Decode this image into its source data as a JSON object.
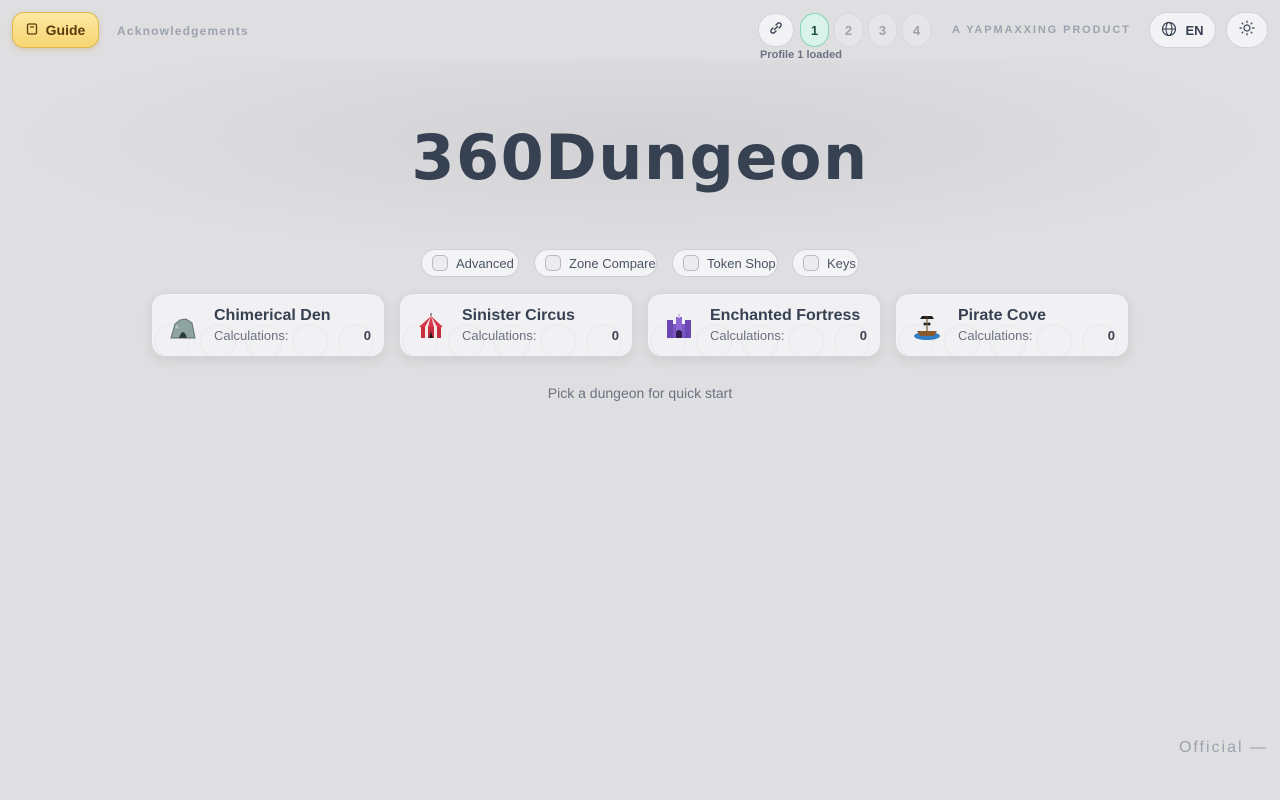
{
  "header": {
    "guide_label": "Guide",
    "acknowledgements_label": "Acknowledgements",
    "profiles": [
      "1",
      "2",
      "3",
      "4"
    ],
    "active_profile": "1",
    "profile_status": "Profile 1 loaded",
    "brand": "A YAPMAXXING PRODUCT",
    "language": "EN"
  },
  "main": {
    "title": "360Dungeon",
    "toggles": [
      {
        "label": "Advanced",
        "checked": false
      },
      {
        "label": "Zone Compare",
        "checked": false
      },
      {
        "label": "Token Shop",
        "checked": false
      },
      {
        "label": "Keys",
        "checked": false
      }
    ],
    "dungeons": [
      {
        "name": "Chimerical Den",
        "calc_label": "Calculations:",
        "calc_value": "0",
        "icon": "cave-icon"
      },
      {
        "name": "Sinister Circus",
        "calc_label": "Calculations:",
        "calc_value": "0",
        "icon": "circus-tent-icon"
      },
      {
        "name": "Enchanted Fortress",
        "calc_label": "Calculations:",
        "calc_value": "0",
        "icon": "castle-icon"
      },
      {
        "name": "Pirate Cove",
        "calc_label": "Calculations:",
        "calc_value": "0",
        "icon": "pirate-ship-icon"
      }
    ],
    "hint": "Pick a dungeon for quick start"
  },
  "footer": {
    "official": "Official —"
  },
  "colors": {
    "background": "#dfdfe1",
    "guide_accent": "#f7d572",
    "active_profile": "#d9f3ea",
    "title": "#364152"
  }
}
